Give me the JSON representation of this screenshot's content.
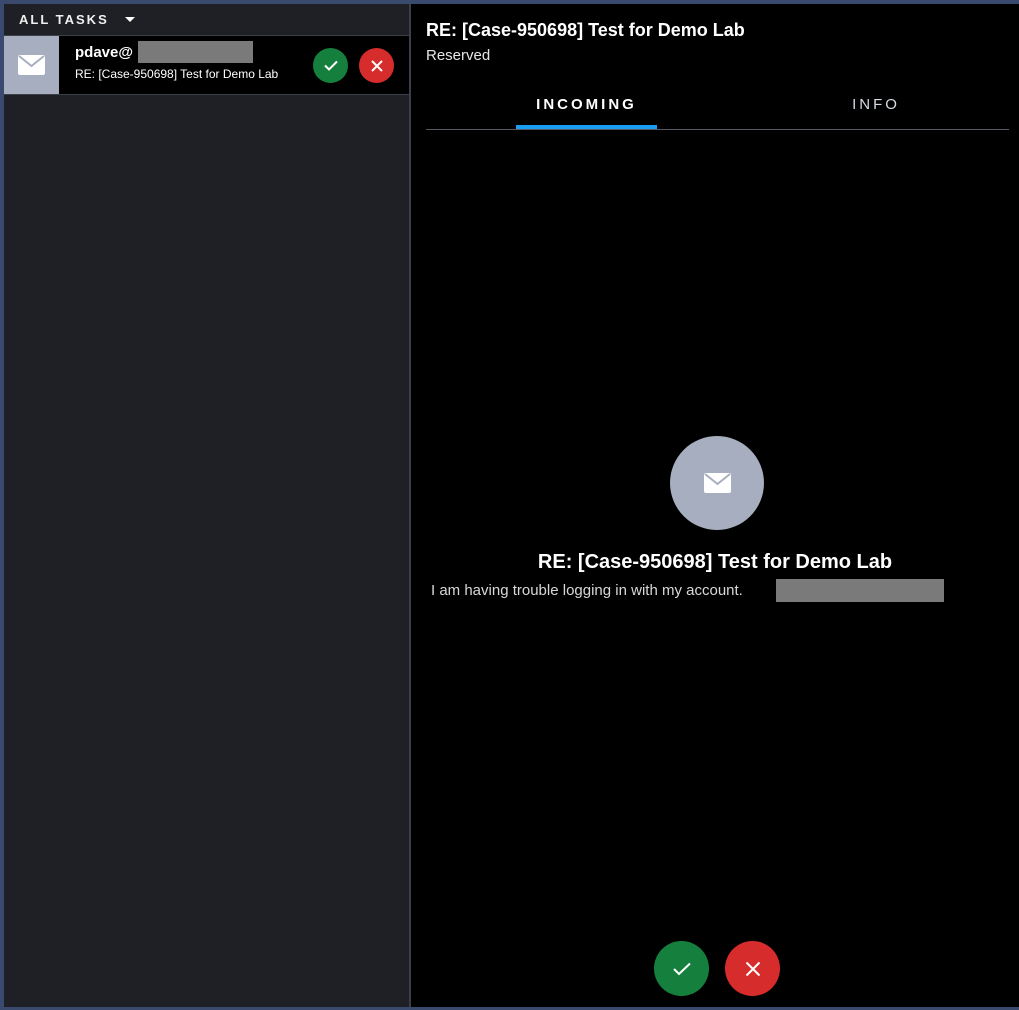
{
  "sidebar": {
    "header_label": "ALL TASKS",
    "tasks": [
      {
        "from": "pdave@",
        "subject": "RE: [Case-950698] Test for Demo Lab",
        "icon": "mail-icon"
      }
    ]
  },
  "detail": {
    "title": "RE: [Case-950698] Test for Demo Lab",
    "status": "Reserved",
    "tabs": [
      {
        "label": "INCOMING",
        "active": true
      },
      {
        "label": "INFO",
        "active": false
      }
    ],
    "center_title": "RE: [Case-950698] Test for Demo Lab",
    "message": "I am having trouble logging in with my account."
  },
  "colors": {
    "accept": "#15803d",
    "reject": "#d72c2c",
    "tab_indicator": "#1a9cf0",
    "avatar": "#a6aebf"
  }
}
